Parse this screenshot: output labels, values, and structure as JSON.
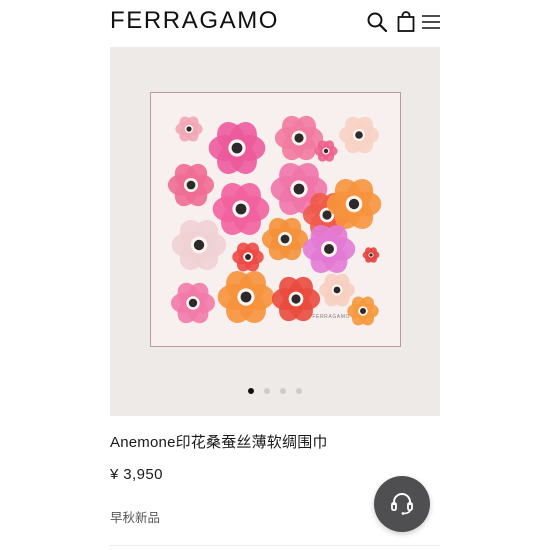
{
  "header": {
    "logo": "FERRAGAMO",
    "icons": [
      "search-icon",
      "shopping-bag-icon",
      "menu-icon"
    ]
  },
  "gallery": {
    "scarf_label": "FERRAGAMO",
    "slides_total": 4,
    "active_slide": 1
  },
  "product": {
    "name": "Anemone印花桑蚕丝薄软绸围巾",
    "price": "¥ 3,950",
    "tag": "早秋新品"
  },
  "chat": {
    "icon": "customer-service-headset-icon",
    "color": "#4f4f51"
  },
  "colors": {
    "scarf_border": "#b89aa3",
    "gallery_bg": "#eeeae7"
  }
}
